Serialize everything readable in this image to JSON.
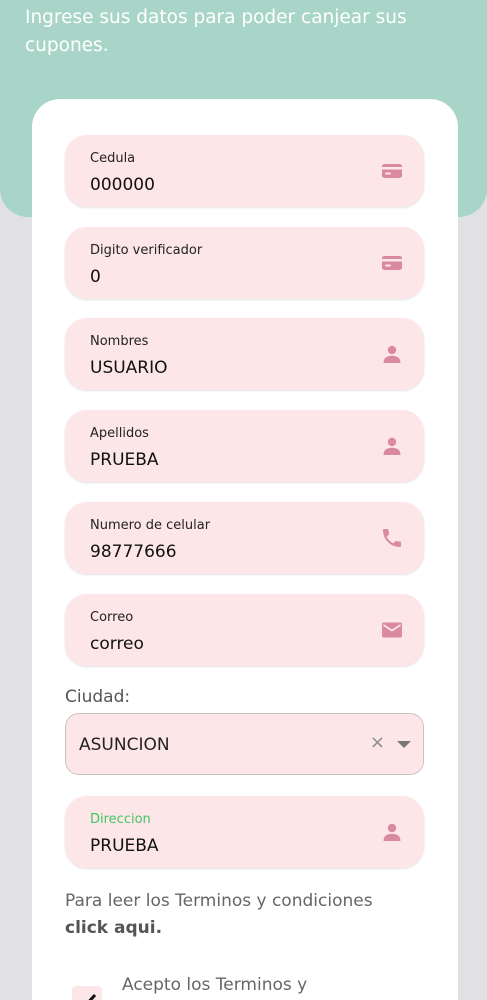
{
  "intro": {
    "text": "Ingrese sus datos para poder canjear sus cupones."
  },
  "fields": [
    {
      "label": "Cedula",
      "value": "000000",
      "icon": "id-card-icon"
    },
    {
      "label": "Digito verificador",
      "value": "0",
      "icon": "id-card-icon"
    },
    {
      "label": "Nombres",
      "value": "USUARIO",
      "icon": "person-icon"
    },
    {
      "label": "Apellidos",
      "value": "PRUEBA",
      "icon": "person-icon"
    },
    {
      "label": "Numero de celular",
      "value": "98777666",
      "icon": "phone-icon"
    },
    {
      "label": "Correo",
      "value": "correo",
      "icon": "mail-icon"
    }
  ],
  "city": {
    "label": "Ciudad:",
    "value": "ASUNCION",
    "clear_symbol": "×"
  },
  "address": {
    "label": "Direccion",
    "value": "PRUEBA",
    "icon": "person-icon"
  },
  "terms": {
    "text": "Para leer los Terminos y condiciones",
    "link": "click aqui."
  },
  "accept": {
    "label": "Acepto los Terminos y"
  },
  "colors": {
    "header": "#a8d5c8",
    "field_bg": "#fde6e8",
    "icon": "#d98aa0",
    "focused_label": "#43c463"
  }
}
